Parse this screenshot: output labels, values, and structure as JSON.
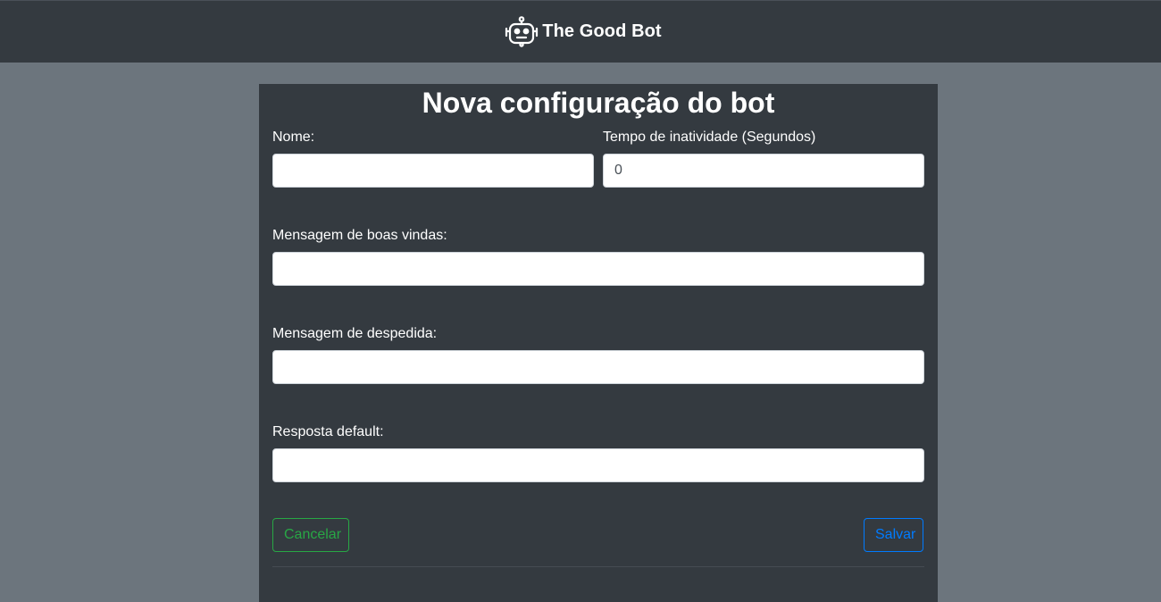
{
  "header": {
    "brand_icon": "robot-icon",
    "brand_name": "The Good Bot"
  },
  "form": {
    "title": "Nova configuração do bot",
    "name": {
      "label": "Nome:",
      "value": ""
    },
    "inactivity": {
      "label": "Tempo de inatividade (Segundos)",
      "value": "0"
    },
    "welcome": {
      "label": "Mensagem de boas vindas:",
      "value": ""
    },
    "farewell": {
      "label": "Mensagem de despedida:",
      "value": ""
    },
    "default_reply": {
      "label": "Resposta default:",
      "value": ""
    },
    "cancel_label": "Cancelar",
    "save_label": "Salvar"
  },
  "colors": {
    "navbar": "#343a40",
    "background": "#6c757d",
    "cancel": "#28a745",
    "save": "#007bff"
  }
}
